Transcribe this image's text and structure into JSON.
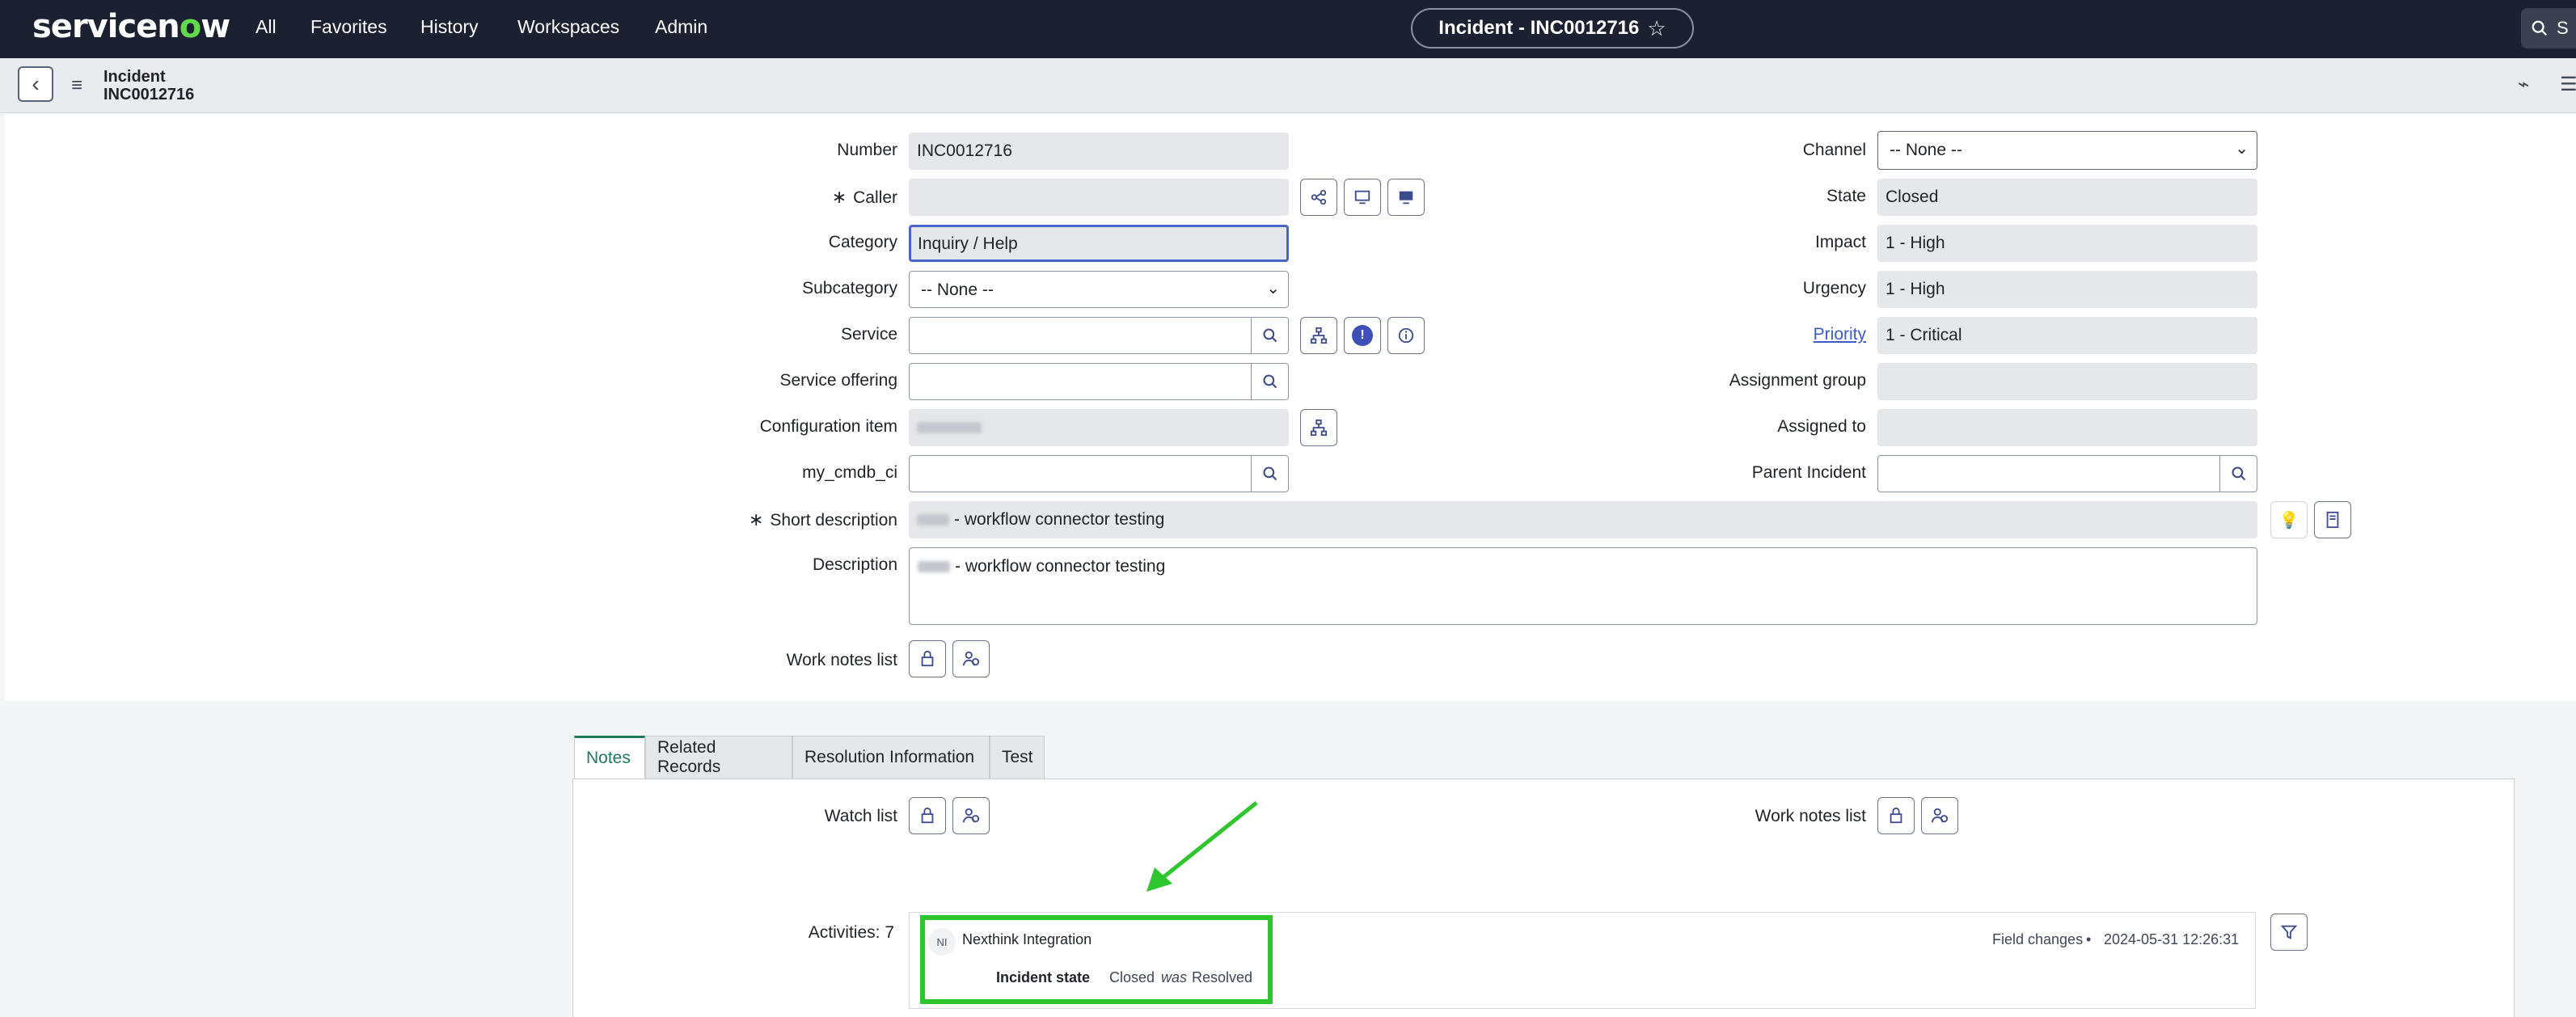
{
  "nav": {
    "logo_pre": "servicen",
    "logo_o": "o",
    "logo_post": "w",
    "links": [
      "All",
      "Favorites",
      "History",
      "Workspaces",
      "Admin"
    ],
    "record_pill": "Incident - INC0012716",
    "search_text": "S"
  },
  "header": {
    "table": "Incident",
    "number": "INC0012716"
  },
  "form": {
    "number_label": "Number",
    "number_value": "INC0012716",
    "caller_label": "Caller",
    "category_label": "Category",
    "category_value": "Inquiry / Help",
    "subcategory_label": "Subcategory",
    "subcategory_value": "-- None --",
    "service_label": "Service",
    "service_offering_label": "Service offering",
    "ci_label": "Configuration item",
    "cmdb_label": "my_cmdb_ci",
    "short_desc_label": "Short description",
    "short_desc_value": "- workflow connector testing",
    "description_label": "Description",
    "description_value": "- workflow connector testing",
    "work_notes_list_label": "Work notes list",
    "channel_label": "Channel",
    "channel_value": "-- None --",
    "state_label": "State",
    "state_value": "Closed",
    "impact_label": "Impact",
    "impact_value": "1 - High",
    "urgency_label": "Urgency",
    "urgency_value": "1 - High",
    "priority_label": "Priority",
    "priority_value": "1 - Critical",
    "assignment_group_label": "Assignment group",
    "assigned_to_label": "Assigned to",
    "parent_incident_label": "Parent Incident",
    "required_marker": "∗"
  },
  "tabs": [
    "Notes",
    "Related Records",
    "Resolution Information",
    "Test"
  ],
  "notes": {
    "watch_list_label": "Watch list",
    "work_notes_list_label": "Work notes list",
    "activities_label": "Activities: 7"
  },
  "activity": {
    "avatar_initials": "NI",
    "author": "Nexthink Integration",
    "type": "Field changes",
    "separator": "•",
    "timestamp": "2024-05-31 12:26:31",
    "field": "Incident state",
    "new_value": "Closed",
    "was_word": "was",
    "old_value": "Resolved"
  },
  "colors": {
    "nav_bg": "#1b2130",
    "brand_green": "#62d84e",
    "highlight_green": "#2ec52e",
    "active_tab": "#1f7a5a",
    "link_blue": "#3d5bc4"
  }
}
